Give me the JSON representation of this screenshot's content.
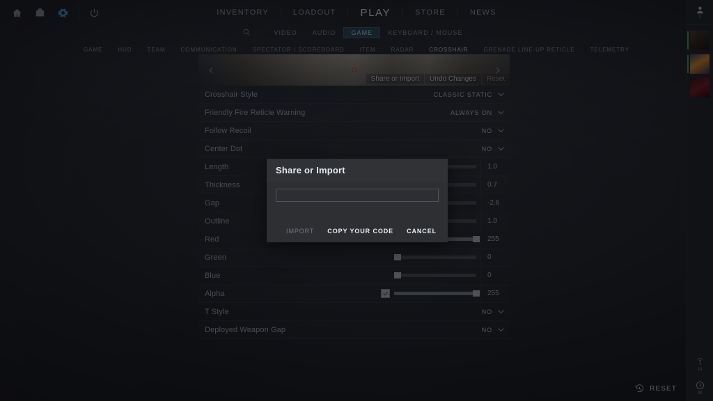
{
  "system_icons": [
    {
      "name": "home-icon",
      "label": "Home"
    },
    {
      "name": "watch-icon",
      "label": "Watch"
    },
    {
      "name": "gear-icon",
      "label": "Settings"
    },
    {
      "name": "power-icon",
      "label": "Power"
    }
  ],
  "main_nav": {
    "items": [
      {
        "label": "INVENTORY",
        "selected": false
      },
      {
        "label": "LOADOUT",
        "selected": false
      },
      {
        "label": "PLAY",
        "selected": true
      },
      {
        "label": "STORE",
        "selected": false
      },
      {
        "label": "NEWS",
        "selected": false
      }
    ]
  },
  "settings_categories": {
    "search_icon": "search-icon",
    "items": [
      {
        "label": "VIDEO",
        "selected": false
      },
      {
        "label": "AUDIO",
        "selected": false
      },
      {
        "label": "GAME",
        "selected": true
      },
      {
        "label": "KEYBOARD / MOUSE",
        "selected": false
      }
    ]
  },
  "tabs": [
    {
      "label": "GAME",
      "selected": false
    },
    {
      "label": "HUD",
      "selected": false
    },
    {
      "label": "TEAM",
      "selected": false
    },
    {
      "label": "COMMUNICATION",
      "selected": false
    },
    {
      "label": "SPECTATOR / SCOREBOARD",
      "selected": false
    },
    {
      "label": "ITEM",
      "selected": false
    },
    {
      "label": "RADAR",
      "selected": false
    },
    {
      "label": "CROSSHAIR",
      "selected": true
    },
    {
      "label": "GRENADE LINE-UP RETICLE",
      "selected": false
    },
    {
      "label": "TELEMETRY",
      "selected": false
    }
  ],
  "preview": {
    "prev_arrow": "chevron-left-icon",
    "next_arrow": "chevron-right-icon",
    "actions": [
      {
        "label": "Share or Import",
        "muted": false
      },
      {
        "label": "Undo Changes",
        "muted": false
      },
      {
        "label": "Reset",
        "muted": true
      }
    ]
  },
  "settings_rows": [
    {
      "label": "Crosshair Style",
      "type": "dropdown",
      "value": "CLASSIC STATIC"
    },
    {
      "label": "Friendly Fire Reticle Warning",
      "type": "dropdown",
      "value": "ALWAYS ON"
    },
    {
      "label": "Follow Recoil",
      "type": "dropdown",
      "value": "NO"
    },
    {
      "label": "Center Dot",
      "type": "dropdown",
      "value": "NO"
    },
    {
      "label": "Length",
      "type": "slider",
      "value": "1.0",
      "percent": 38,
      "checkbox": false
    },
    {
      "label": "Thickness",
      "type": "slider",
      "value": "0.7",
      "percent": 30,
      "checkbox": false
    },
    {
      "label": "Gap",
      "type": "slider",
      "value": "-2.6",
      "percent": 26,
      "checkbox": false
    },
    {
      "label": "Outline",
      "type": "slider",
      "value": "1.0",
      "percent": 33,
      "checkbox": false
    },
    {
      "label": "Red",
      "type": "slider",
      "value": "255",
      "percent": 100,
      "checkbox": false
    },
    {
      "label": "Green",
      "type": "slider",
      "value": "0",
      "percent": 3,
      "checkbox": false
    },
    {
      "label": "Blue",
      "type": "slider",
      "value": "0",
      "percent": 3,
      "checkbox": false
    },
    {
      "label": "Alpha",
      "type": "slider",
      "value": "255",
      "percent": 100,
      "checkbox": true
    },
    {
      "label": "T Style",
      "type": "dropdown",
      "value": "NO"
    },
    {
      "label": "Deployed Weapon Gap",
      "type": "dropdown",
      "value": "NO"
    }
  ],
  "modal": {
    "title": "Share or Import",
    "input_value": "",
    "input_placeholder": "",
    "buttons": [
      {
        "label": "IMPORT",
        "disabled": true
      },
      {
        "label": "COPY YOUR CODE",
        "disabled": false
      },
      {
        "label": "CANCEL",
        "disabled": false
      }
    ]
  },
  "right_rail": {
    "player_icon": "person-icon",
    "player_count": "3",
    "avatars": [
      {
        "name": "avatar-1"
      },
      {
        "name": "avatar-2"
      },
      {
        "name": "avatar-3"
      }
    ],
    "bottom_items": [
      {
        "icon": "broadcast-icon",
        "count": "14"
      },
      {
        "icon": "history-clock-icon",
        "count": "39"
      }
    ]
  },
  "bottom_bar": {
    "reset_icon": "reset-clock-icon",
    "reset_label": "RESET"
  },
  "colors": {
    "accent_blue": "#3b9cd0",
    "selected_tab_bg": "#3e789b",
    "panel_bg": "#2d2f33",
    "online_green": "#3fa85a",
    "crosshair_red": "#e12828"
  }
}
